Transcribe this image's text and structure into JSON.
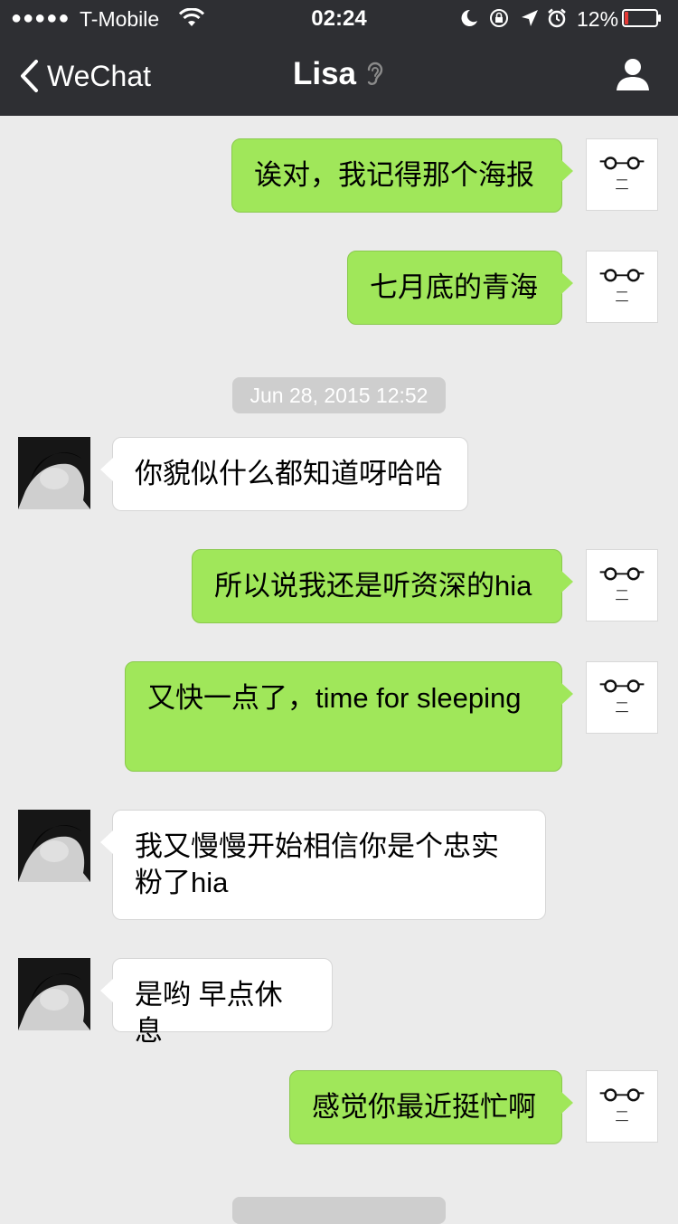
{
  "status_bar": {
    "signal": "●●●●●",
    "carrier": "T-Mobile",
    "time": "02:24",
    "battery_percent": "12%",
    "icons": [
      "wifi-icon",
      "moon-icon",
      "rotation-lock-icon",
      "location-arrow-icon",
      "alarm-icon",
      "battery-icon"
    ],
    "battery_level": 0.12,
    "battery_color": "#e53935"
  },
  "nav": {
    "back_label": "WeChat",
    "title": "Lisa",
    "title_icon": "ear-icon",
    "right_icon": "profile-icon",
    "background": "#2e2f33"
  },
  "colors": {
    "my_bubble": "#a0e75a",
    "their_bubble": "#ffffff",
    "chat_background": "#ebebeb"
  },
  "messages": [
    {
      "sender": "me",
      "text": "诶对，我记得那个海报"
    },
    {
      "sender": "me",
      "text": "七月底的青海"
    },
    {
      "sender": "her",
      "text": "你貌似什么都知道呀哈哈"
    },
    {
      "sender": "me",
      "text": "所以说我还是听资深的hia"
    },
    {
      "sender": "me",
      "text": "又快一点了，time for sleeping"
    },
    {
      "sender": "her",
      "text": "我又慢慢开始相信你是个忠实粉了hia"
    },
    {
      "sender": "her",
      "text": "是哟 早点休息"
    },
    {
      "sender": "me",
      "text": "感觉你最近挺忙啊"
    }
  ],
  "timestamp": "Jun 28, 2015 12:52"
}
